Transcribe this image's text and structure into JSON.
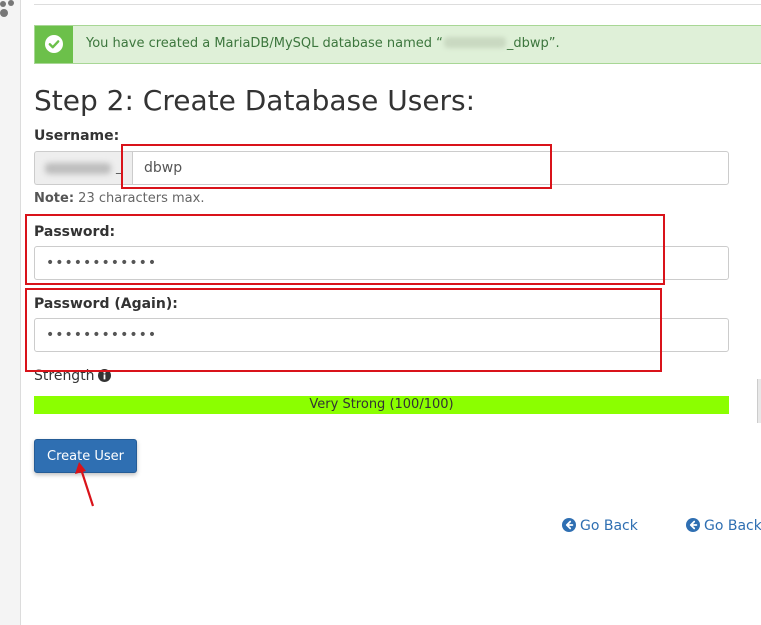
{
  "alert": {
    "text_before": "You have created a MariaDB/MySQL database named “",
    "text_after": "_dbwp”."
  },
  "page_title": "Step 2: Create Database Users:",
  "username": {
    "label": "Username:",
    "prefix_suffix": "_",
    "value": "dbwp",
    "note_bold": "Note:",
    "note_text": " 23 characters max."
  },
  "password": {
    "label": "Password:",
    "value": "••••••••••••"
  },
  "password_again": {
    "label": "Password (Again):",
    "value": "••••••••••••"
  },
  "strength": {
    "label": "Strength",
    "text": "Very Strong (100/100)",
    "fraction": 1.0,
    "color": "#8bff00"
  },
  "create_button": {
    "label": "Create User"
  },
  "go_back_links": [
    "Go Back",
    "Go Back"
  ],
  "icons": {
    "alert": "check-circle-icon",
    "strength_info": "info-circle-icon",
    "go_back": "arrow-circle-left-icon"
  },
  "colors": {
    "primary": "#2f6fb2",
    "success_bg": "#dff0d8",
    "success_icon_bg": "#6cc04a",
    "annotation_red": "#d9131a"
  }
}
